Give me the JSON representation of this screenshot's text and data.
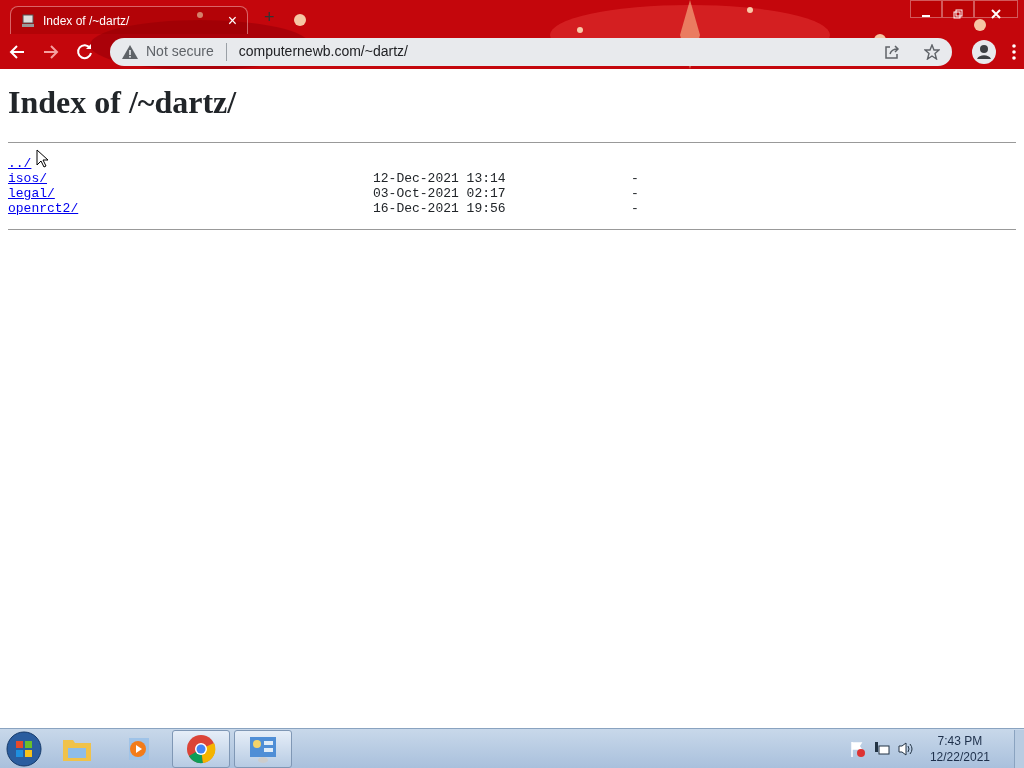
{
  "browser": {
    "tab": {
      "title": "Index of /~dartz/",
      "selected": true,
      "close": "×"
    },
    "new_tab": "+",
    "security": "Not secure",
    "url": "computernewb.com/~dartz/"
  },
  "page": {
    "heading": "Index of /~dartz/",
    "entries": [
      {
        "name": "../"
      },
      {
        "name": "isos/",
        "date": "12-Dec-2021 13:14",
        "size": "-"
      },
      {
        "name": "legal/",
        "date": "03-Oct-2021 02:17",
        "size": "-"
      },
      {
        "name": "openrct2/",
        "date": "16-Dec-2021 19:56",
        "size": "-"
      }
    ]
  },
  "taskbar": {
    "apps": [
      {
        "kind": "explorer",
        "open": false
      },
      {
        "kind": "media",
        "open": false
      },
      {
        "kind": "chrome",
        "open": true
      },
      {
        "kind": "control",
        "open": true
      }
    ],
    "clock": {
      "time": "7:43 PM",
      "date": "12/22/2021"
    }
  }
}
